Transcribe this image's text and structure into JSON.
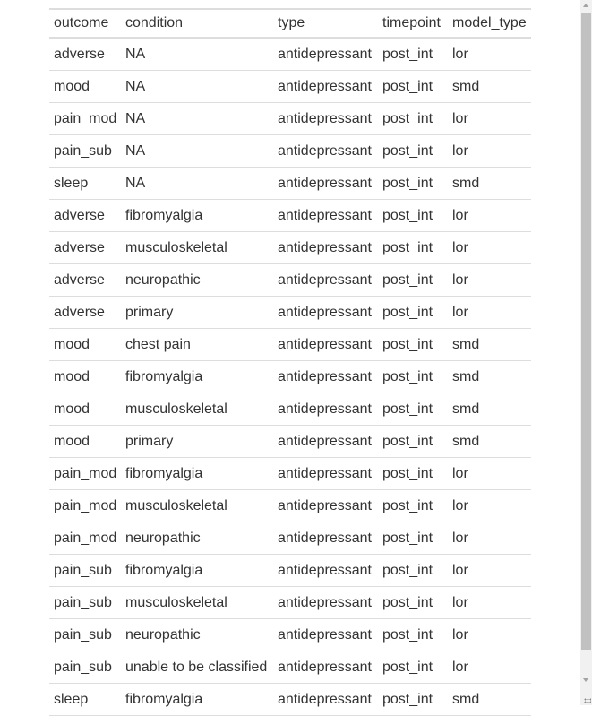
{
  "table": {
    "columns": [
      "outcome",
      "condition",
      "type",
      "timepoint",
      "model_type"
    ],
    "rows": [
      [
        "adverse",
        "NA",
        "antidepressant",
        "post_int",
        "lor"
      ],
      [
        "mood",
        "NA",
        "antidepressant",
        "post_int",
        "smd"
      ],
      [
        "pain_mod",
        "NA",
        "antidepressant",
        "post_int",
        "lor"
      ],
      [
        "pain_sub",
        "NA",
        "antidepressant",
        "post_int",
        "lor"
      ],
      [
        "sleep",
        "NA",
        "antidepressant",
        "post_int",
        "smd"
      ],
      [
        "adverse",
        "fibromyalgia",
        "antidepressant",
        "post_int",
        "lor"
      ],
      [
        "adverse",
        "musculoskeletal",
        "antidepressant",
        "post_int",
        "lor"
      ],
      [
        "adverse",
        "neuropathic",
        "antidepressant",
        "post_int",
        "lor"
      ],
      [
        "adverse",
        "primary",
        "antidepressant",
        "post_int",
        "lor"
      ],
      [
        "mood",
        "chest pain",
        "antidepressant",
        "post_int",
        "smd"
      ],
      [
        "mood",
        "fibromyalgia",
        "antidepressant",
        "post_int",
        "smd"
      ],
      [
        "mood",
        "musculoskeletal",
        "antidepressant",
        "post_int",
        "smd"
      ],
      [
        "mood",
        "primary",
        "antidepressant",
        "post_int",
        "smd"
      ],
      [
        "pain_mod",
        "fibromyalgia",
        "antidepressant",
        "post_int",
        "lor"
      ],
      [
        "pain_mod",
        "musculoskeletal",
        "antidepressant",
        "post_int",
        "lor"
      ],
      [
        "pain_mod",
        "neuropathic",
        "antidepressant",
        "post_int",
        "lor"
      ],
      [
        "pain_sub",
        "fibromyalgia",
        "antidepressant",
        "post_int",
        "lor"
      ],
      [
        "pain_sub",
        "musculoskeletal",
        "antidepressant",
        "post_int",
        "lor"
      ],
      [
        "pain_sub",
        "neuropathic",
        "antidepressant",
        "post_int",
        "lor"
      ],
      [
        "pain_sub",
        "unable to be classified",
        "antidepressant",
        "post_int",
        "lor"
      ],
      [
        "sleep",
        "fibromyalgia",
        "antidepressant",
        "post_int",
        "smd"
      ]
    ]
  }
}
